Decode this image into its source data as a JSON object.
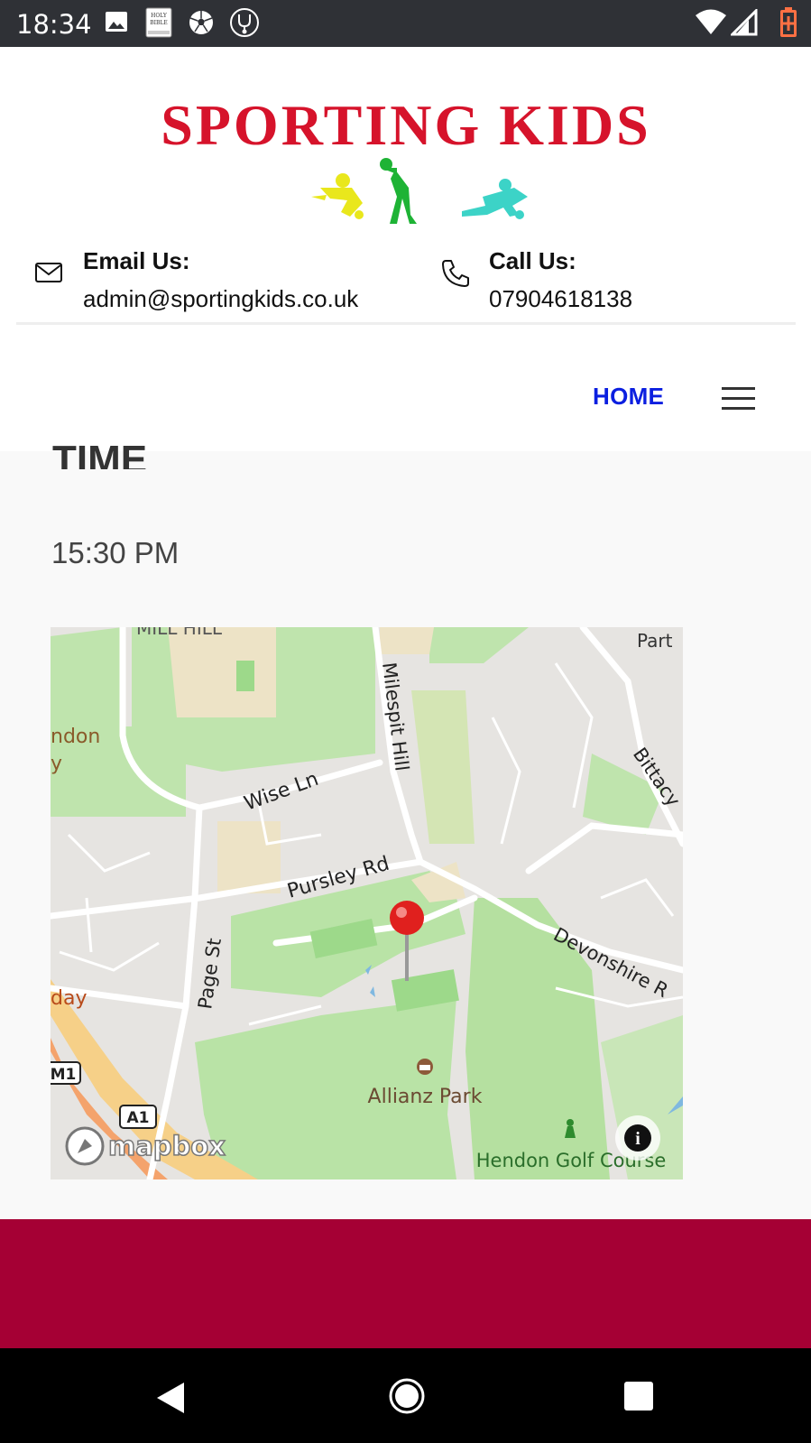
{
  "status_bar": {
    "time": "18:34",
    "icons": [
      "image-icon",
      "bible-icon",
      "soccer-ball-icon",
      "stethoscope-icon",
      "wifi-icon",
      "signal-icon",
      "battery-icon"
    ],
    "bible_text": "HOLY BIBLE"
  },
  "header": {
    "logo_text": "SPORTING KIDS",
    "email": {
      "label": "Email Us:",
      "value": "admin@sportingkids.co.uk"
    },
    "phone": {
      "label": "Call Us:",
      "value": "07904618138"
    },
    "nav": {
      "home_label": "HOME"
    }
  },
  "content": {
    "section_title": "TIME",
    "time_value": "15:30 PM"
  },
  "map": {
    "labels": {
      "mill_hill": "MILL HILL",
      "part": "Part",
      "hendon": "ndon",
      "y": "y",
      "milespit_hill": "Milespit Hill",
      "bittacy": "Bittacy",
      "wise_ln": "Wise Ln",
      "pursley_rd": "Pursley Rd",
      "devonshire": "Devonshire R",
      "page_st": "Page St",
      "day": "day",
      "m1": "M1",
      "a1": "A1",
      "allianz_park": "Allianz Park",
      "hendon_golf": "Hendon Golf Course",
      "attribution": "mapbox",
      "info": "i"
    }
  },
  "colors": {
    "status_bar": "#2f3136",
    "logo_red": "#d6132b",
    "nav_blue": "#0b1fe0",
    "footer": "#a50034",
    "park_green": "#b9e3a6",
    "road": "#ffffff"
  }
}
